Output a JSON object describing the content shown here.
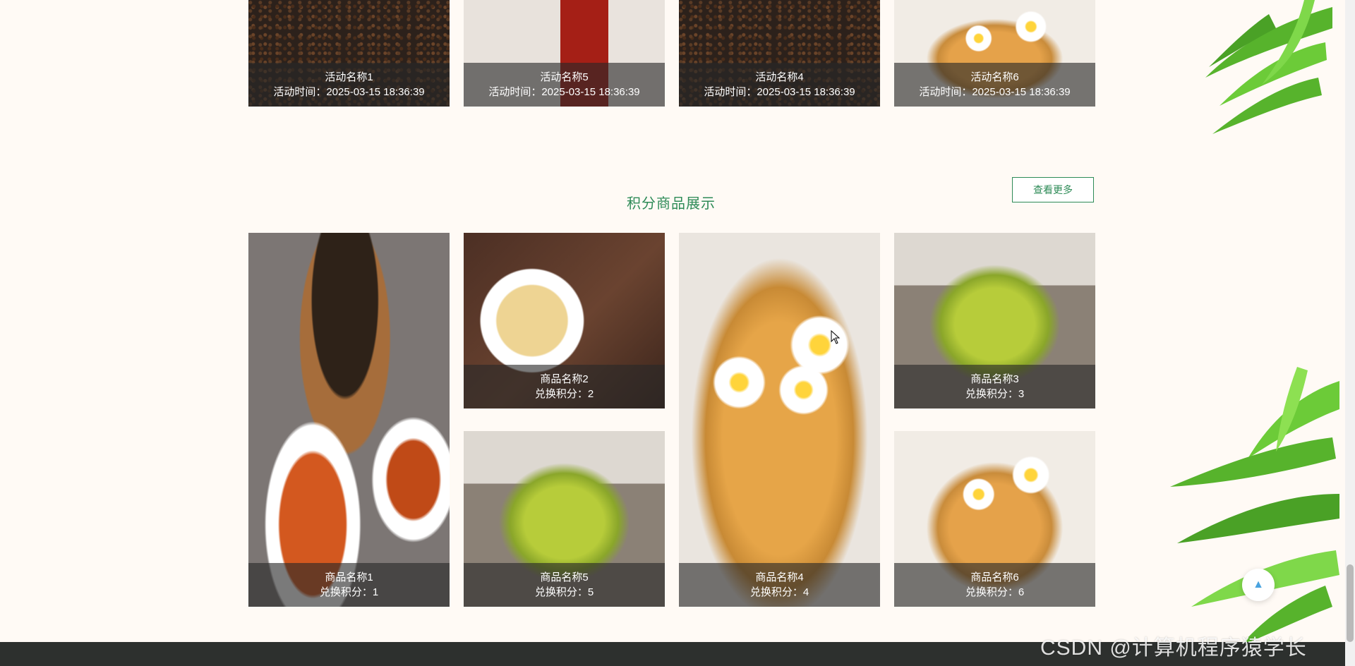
{
  "activities": [
    {
      "name": "活动名称1",
      "time": "活动时间：2025-03-15 18:36:39"
    },
    {
      "name": "活动名称5",
      "time": "活动时间：2025-03-15 18:36:39"
    },
    {
      "name": "活动名称4",
      "time": "活动时间：2025-03-15 18:36:39"
    },
    {
      "name": "活动名称6",
      "time": "活动时间：2025-03-15 18:36:39"
    }
  ],
  "products_section": {
    "title": "积分商品展示",
    "more_label": "查看更多"
  },
  "products": [
    {
      "name": "商品名称1",
      "points": "兑换积分：1"
    },
    {
      "name": "商品名称2",
      "points": "兑换积分：2"
    },
    {
      "name": "商品名称4",
      "points": "兑换积分：4"
    },
    {
      "name": "商品名称3",
      "points": "兑换积分：3"
    },
    {
      "name": "商品名称5",
      "points": "兑换积分：5"
    },
    {
      "name": "商品名称6",
      "points": "兑换积分：6"
    }
  ],
  "back_to_top": {
    "icon": "arrow-up-icon",
    "glyph": "▲"
  },
  "watermark": "CSDN @计算机程序猿学长",
  "colors": {
    "accent": "#2e8b57",
    "page_background": "#fffaf5",
    "caption_overlay": "rgba(40,40,40,0.62)",
    "footer": "#2d302e"
  }
}
